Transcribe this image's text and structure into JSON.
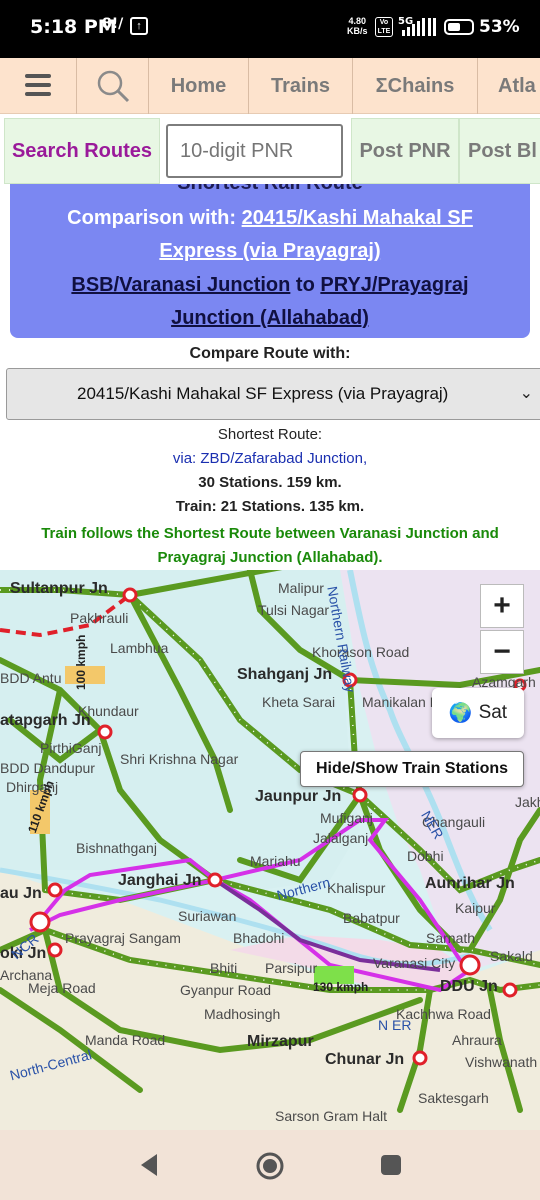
{
  "status_bar": {
    "time": "5:18 PM",
    "left_icons": "8!/",
    "speed_value": "4.80",
    "speed_unit": "KB/s",
    "volte": "Vo LTE",
    "network": "5G",
    "battery": "53%",
    "battery_level": 0.53
  },
  "top_nav": {
    "items": [
      "Home",
      "Trains",
      "ΣChains",
      "Atla"
    ]
  },
  "sec_nav": {
    "search_routes": "Search Routes",
    "pnr_placeholder": "10-digit PNR",
    "post_pnr": "Post PNR",
    "post_blog": "Post Bl"
  },
  "banner": {
    "title": "Shortest Rail Route",
    "compare_prefix": "Comparison with:",
    "compare_train": "20415/Kashi Mahakal SF Express (via Prayagraj)",
    "from": "BSB/Varanasi Junction",
    "to_word": "to",
    "to": "PRYJ/Prayagraj Junction (Allahabad)"
  },
  "compare": {
    "label": "Compare Route with:",
    "selected": "20415/Kashi Mahakal SF Express (via Prayagraj)"
  },
  "route_info": {
    "heading": "Shortest Route:",
    "via": "via: ZBD/Zafarabad Junction,",
    "shortest_stats": "30 Stations. 159 km.",
    "train_stats": "Train: 21 Stations. 135 km.",
    "note": "Train follows the Shortest Route between Varanasi Junction and Prayagraj Junction (Allahabad)."
  },
  "map": {
    "zoom_in": "+",
    "zoom_out": "−",
    "sat_label": "Sat",
    "hide_show": "Hide/Show Train Stations",
    "labels": [
      "Sultanpur Jn",
      "Pakhrauli",
      "Lambhua",
      "Malipur",
      "Tulsi Nagar",
      "Khorason Road",
      "Shahganj Jn",
      "Azamgarh",
      "Kheta Sarai",
      "Manikalan H",
      "BDD Antu",
      "Khundaur",
      "atapgarh Jn",
      "PirthiGanj",
      "Shri Krishna Nagar",
      "BDD Dandupur",
      "Dhirganj",
      "Bishnathganj",
      "Jaunpur Jn",
      "Mufiganj",
      "Jalalganj",
      "Changauli",
      "Jakh",
      "Dobhi",
      "Mariahu",
      "Janghai Jn",
      "Khalispur",
      "Aunrihar Jn",
      "au Jn",
      "Kaipur",
      "Suriawan",
      "Babatpur",
      "Sarnath",
      "Bhadohi",
      "Parsipur",
      "Varanasi City",
      "Prayagraj Sangam",
      "Bhiti",
      "oki Jn",
      "Archana",
      "Gyanpur Road",
      "Sakald",
      "Madhosingh",
      "Kachhwa Road",
      "DDU Jn",
      "Meja Road",
      "Manda Road",
      "Mirzapur",
      "Chunar Jn",
      "Ahraura",
      "Vishwanath Puri",
      "Saktesgarh",
      "Sarson Gram Halt"
    ],
    "rail_labels": [
      "Northern",
      "NER",
      "NCR",
      "North-Central",
      "N ER",
      "Northern Railway"
    ],
    "speed_labels": [
      "100 kmph",
      "110 kmph",
      "130 kmph"
    ]
  },
  "bottom_nav": {
    "back": "back",
    "home": "home",
    "recents": "recents"
  }
}
